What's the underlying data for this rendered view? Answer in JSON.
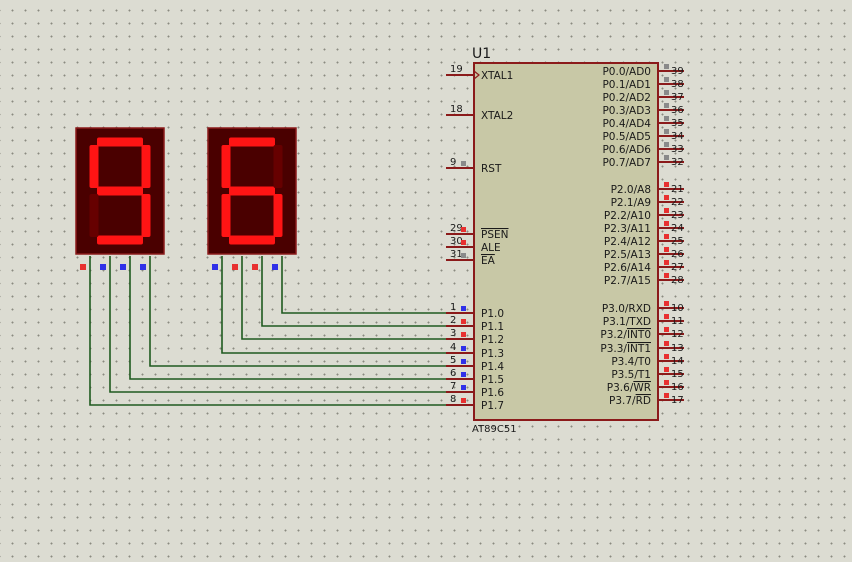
{
  "chip": {
    "ref": "U1",
    "part": "AT89C51",
    "left_pins": [
      {
        "num": "19",
        "label": "XTAL1",
        "clock": true
      },
      {
        "num": "18",
        "label": "XTAL2"
      },
      {
        "num": "9",
        "label": "RST",
        "state": "gray"
      },
      {
        "num": "29",
        "label": "PSEN",
        "overline": true,
        "state": "red"
      },
      {
        "num": "30",
        "label": "ALE",
        "state": "red"
      },
      {
        "num": "31",
        "label": "EA",
        "overline": true,
        "state": "gray"
      },
      {
        "num": "1",
        "label": "P1.0",
        "state": "blue"
      },
      {
        "num": "2",
        "label": "P1.1",
        "state": "red"
      },
      {
        "num": "3",
        "label": "P1.2",
        "state": "red"
      },
      {
        "num": "4",
        "label": "P1.3",
        "state": "blue"
      },
      {
        "num": "5",
        "label": "P1.4",
        "state": "blue"
      },
      {
        "num": "6",
        "label": "P1.5",
        "state": "blue"
      },
      {
        "num": "7",
        "label": "P1.6",
        "state": "blue"
      },
      {
        "num": "8",
        "label": "P1.7",
        "state": "red"
      }
    ],
    "right_pins": [
      {
        "num": "39",
        "label": "P0.0/AD0",
        "state": "gray"
      },
      {
        "num": "38",
        "label": "P0.1/AD1",
        "state": "gray"
      },
      {
        "num": "37",
        "label": "P0.2/AD2",
        "state": "gray"
      },
      {
        "num": "36",
        "label": "P0.3/AD3",
        "state": "gray"
      },
      {
        "num": "35",
        "label": "P0.4/AD4",
        "state": "gray"
      },
      {
        "num": "34",
        "label": "P0.5/AD5",
        "state": "gray"
      },
      {
        "num": "33",
        "label": "P0.6/AD6",
        "state": "gray"
      },
      {
        "num": "32",
        "label": "P0.7/AD7",
        "state": "gray"
      },
      {
        "num": "21",
        "label": "P2.0/A8",
        "state": "red"
      },
      {
        "num": "22",
        "label": "P2.1/A9",
        "state": "red"
      },
      {
        "num": "23",
        "label": "P2.2/A10",
        "state": "red"
      },
      {
        "num": "24",
        "label": "P2.3/A11",
        "state": "red"
      },
      {
        "num": "25",
        "label": "P2.4/A12",
        "state": "red"
      },
      {
        "num": "26",
        "label": "P2.5/A13",
        "state": "red"
      },
      {
        "num": "27",
        "label": "P2.6/A14",
        "state": "red"
      },
      {
        "num": "28",
        "label": "P2.7/A15",
        "state": "red"
      },
      {
        "num": "10",
        "label": "P3.0/RXD",
        "state": "red"
      },
      {
        "num": "11",
        "label": "P3.1/TXD",
        "state": "red"
      },
      {
        "num": "12",
        "label": "P3.2/",
        "over": "INT0",
        "state": "red"
      },
      {
        "num": "13",
        "label": "P3.3/",
        "over": "INT1",
        "state": "red"
      },
      {
        "num": "14",
        "label": "P3.4/T0",
        "state": "red"
      },
      {
        "num": "15",
        "label": "P3.5/T1",
        "state": "red"
      },
      {
        "num": "16",
        "label": "P3.6/",
        "over": "WR",
        "state": "red"
      },
      {
        "num": "17",
        "label": "P3.7/",
        "over": "RD",
        "state": "red"
      }
    ]
  },
  "displays": [
    {
      "digit": "9",
      "segments": {
        "a": 1,
        "b": 1,
        "c": 1,
        "d": 1,
        "e": 0,
        "f": 1,
        "g": 1
      },
      "pin_states": [
        "red",
        "blue",
        "blue",
        "blue"
      ]
    },
    {
      "digit": "6",
      "segments": {
        "a": 1,
        "b": 0,
        "c": 1,
        "d": 1,
        "e": 1,
        "f": 1,
        "g": 1
      },
      "pin_states": [
        "blue",
        "red",
        "red",
        "blue"
      ]
    }
  ],
  "colors": {
    "wire": "#1f5a1f",
    "chip_fill": "#c8c8a6",
    "chip_border": "#8b1a1a",
    "seg_on": "#ff1414",
    "seg_off": "#660000",
    "display_bg": "#4a0000",
    "state_red": "#e83030",
    "state_blue": "#3030e8",
    "state_gray": "#8a8a8a"
  }
}
